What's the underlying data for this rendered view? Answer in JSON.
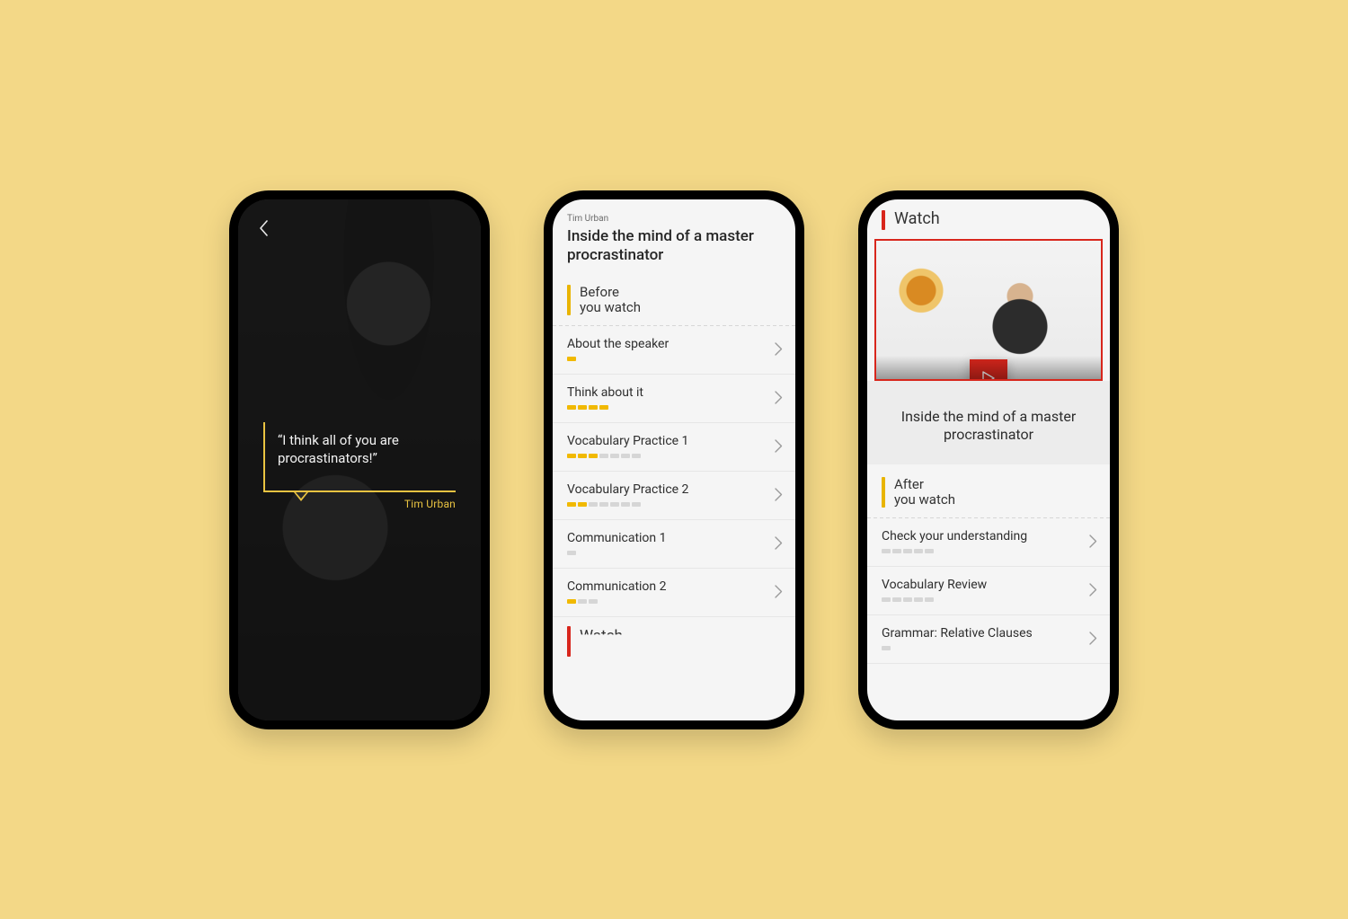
{
  "colors": {
    "accentYellow": "#e9b400",
    "accentRed": "#d8261c",
    "bg": "#f3d887"
  },
  "phone1": {
    "quote": "“I think all of you are procrastinators!”",
    "author": "Tim Urban"
  },
  "phone2": {
    "speaker": "Tim Urban",
    "title": "Inside the mind of a master procrastinator",
    "section": {
      "line1": "Before",
      "line2": "you watch"
    },
    "rows": [
      {
        "label": "About the speaker",
        "done": 1,
        "total": 1
      },
      {
        "label": "Think about it",
        "done": 4,
        "total": 4
      },
      {
        "label": "Vocabulary Practice 1",
        "done": 3,
        "total": 7
      },
      {
        "label": "Vocabulary Practice 2",
        "done": 2,
        "total": 7
      },
      {
        "label": "Communication 1",
        "done": 0,
        "total": 1
      },
      {
        "label": "Communication 2",
        "done": 1,
        "total": 3
      }
    ],
    "nextSection": "Watch"
  },
  "phone3": {
    "watchLabel": "Watch",
    "videoTitle": "Inside the mind of a master procrastinator",
    "section": {
      "line1": "After",
      "line2": "you watch"
    },
    "rows": [
      {
        "label": "Check your understanding",
        "done": 0,
        "total": 5
      },
      {
        "label": "Vocabulary Review",
        "done": 0,
        "total": 5
      },
      {
        "label": "Grammar: Relative Clauses",
        "done": 0,
        "total": 1
      }
    ]
  }
}
